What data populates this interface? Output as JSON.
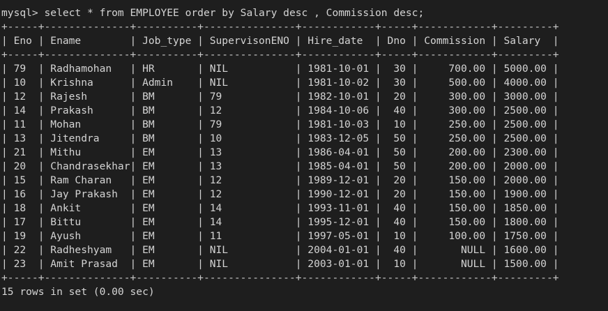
{
  "terminal": {
    "command": "mysql> select * from EMPLOYEE order by Salary desc , Commission desc;",
    "separator": "+-----+--------------+----------+---------------+------------+-----+------------+---------+",
    "header": "| Eno | Ename        | Job_type | SupervisonENO | Hire_date  | Dno | Commission | Salary  |",
    "rows": [
      "| 79  | Radhamohan   | HR       | NIL           | 1981-10-01 |  30 |     700.00 | 5000.00 |",
      "| 10  | Krishna      | Admin    | NIL           | 1981-10-02 |  30 |     500.00 | 4000.00 |",
      "| 12  | Rajesh       | BM       | 79            | 1982-10-01 |  20 |     300.00 | 3000.00 |",
      "| 14  | Prakash      | BM       | 12            | 1984-10-06 |  40 |     300.00 | 2500.00 |",
      "| 11  | Mohan        | BM       | 79            | 1981-10-03 |  10 |     250.00 | 2500.00 |",
      "| 13  | Jitendra     | BM       | 10            | 1983-12-05 |  50 |     250.00 | 2500.00 |",
      "| 21  | Mithu        | EM       | 13            | 1986-04-01 |  50 |     200.00 | 2300.00 |",
      "| 20  | Chandrasekhar| EM       | 13            | 1985-04-01 |  50 |     200.00 | 2000.00 |",
      "| 15  | Ram Charan   | EM       | 12            | 1989-12-01 |  20 |     150.00 | 2000.00 |",
      "| 16  | Jay Prakash  | EM       | 12            | 1990-12-01 |  20 |     150.00 | 1900.00 |",
      "| 18  | Ankit        | EM       | 14            | 1993-11-01 |  40 |     150.00 | 1850.00 |",
      "| 17  | Bittu        | EM       | 14            | 1995-12-01 |  40 |     150.00 | 1800.00 |",
      "| 19  | Ayush        | EM       | 11            | 1997-05-01 |  10 |     100.00 | 1750.00 |",
      "| 22  | Radheshyam   | EM       | NIL           | 2004-01-01 |  40 |       NULL | 1600.00 |",
      "| 23  | Amit Prasad  | EM       | NIL           | 2003-01-01 |  10 |       NULL | 1500.00 |"
    ],
    "footer": "15 rows in set (0.00 sec)"
  }
}
